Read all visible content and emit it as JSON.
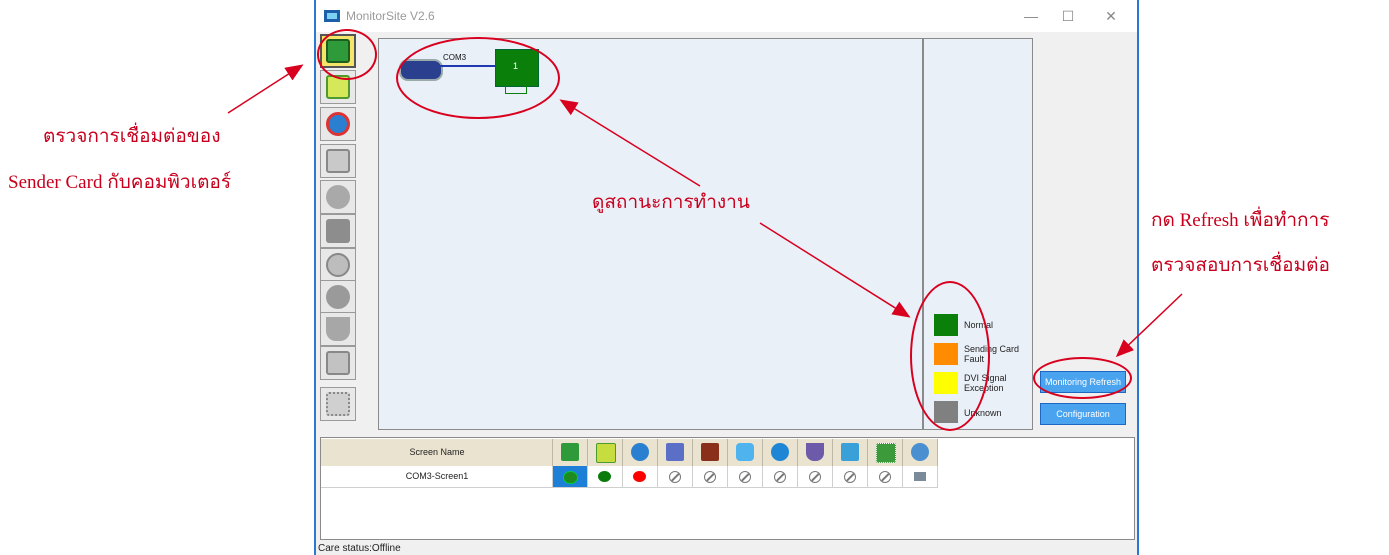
{
  "window": {
    "title": "MonitorSite V2.6",
    "controls": {
      "minimize": "—",
      "maximize": "☐",
      "close": "✕"
    }
  },
  "toolbar_icons": [
    "sender-card-icon",
    "receiving-card-icon",
    "temperature-icon",
    "monitoring-card-icon",
    "smoke-icon",
    "fan-icon",
    "voltage-icon",
    "magnet-icon",
    "exit-icon",
    "module-icon"
  ],
  "topology": {
    "port_label": "COM3",
    "card_label": "1"
  },
  "legend": {
    "items": [
      {
        "label": "Normal",
        "color": "#0a7f0a"
      },
      {
        "label": "Sending Card Fault",
        "color": "#ff8c00"
      },
      {
        "label": "DVI Signal Exception",
        "color": "#ffff00"
      },
      {
        "label": "Unknown",
        "color": "#808080"
      }
    ]
  },
  "buttons": {
    "refresh": "Monitoring Refresh",
    "configuration": "Configuration"
  },
  "table": {
    "header": "Screen Name",
    "row_name": "COM3-Screen1",
    "header_icons": [
      "sender-card-icon",
      "receiving-card-icon",
      "temperature-icon",
      "monitoring-card-icon",
      "smoke-icon",
      "fan-icon",
      "voltage-icon",
      "magnet-icon",
      "exit-icon",
      "module-icon",
      "globe-icon"
    ],
    "row_status": [
      "green-selected",
      "green",
      "red",
      "na",
      "na",
      "na",
      "na",
      "na",
      "na",
      "na",
      "monitor"
    ]
  },
  "status_bar": "Care status:Offline",
  "annotations": {
    "left_line1": "ตรวจการเชื่อมต่อของ",
    "left_line2": "Sender Card กับคอมพิวเตอร์",
    "middle": "ดูสถานะการทำงาน",
    "right_line1": "กด Refresh เพื่อทำการ",
    "right_line2": "ตรวจสอบการเชื่อมต่อ"
  },
  "colors": {
    "annotation": "#c8001e",
    "accent": "#4aa3ef",
    "normal": "#0a7f0a"
  }
}
